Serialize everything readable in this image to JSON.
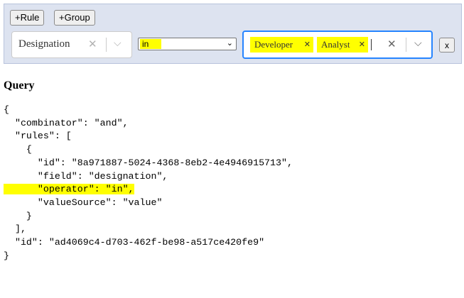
{
  "toolbar": {
    "add_rule_label": "+Rule",
    "add_group_label": "+Group"
  },
  "rule": {
    "field_value": "Designation",
    "operator_value": "in",
    "values": [
      "Developer",
      "Analyst"
    ],
    "remove_label": "x"
  },
  "query": {
    "heading": "Query",
    "lines": [
      "{",
      "  \"combinator\": \"and\",",
      "  \"rules\": [",
      "    {",
      "      \"id\": \"8a971887-5024-4368-8eb2-4e4946915713\",",
      "      \"field\": \"designation\",",
      "      \"operator\": \"in\",",
      "      \"valueSource\": \"value\"",
      "    }",
      "  ],",
      "  \"id\": \"ad4069c4-d703-462f-be98-a517ce420fe9\"",
      "}"
    ]
  },
  "colors": {
    "highlight": "#ffff00",
    "focus_border": "#2684ff",
    "panel_bg": "#dde3f0"
  },
  "icons": {
    "clear": "close-icon",
    "dropdown": "chevron-down-icon",
    "chip_remove": "close-icon"
  }
}
